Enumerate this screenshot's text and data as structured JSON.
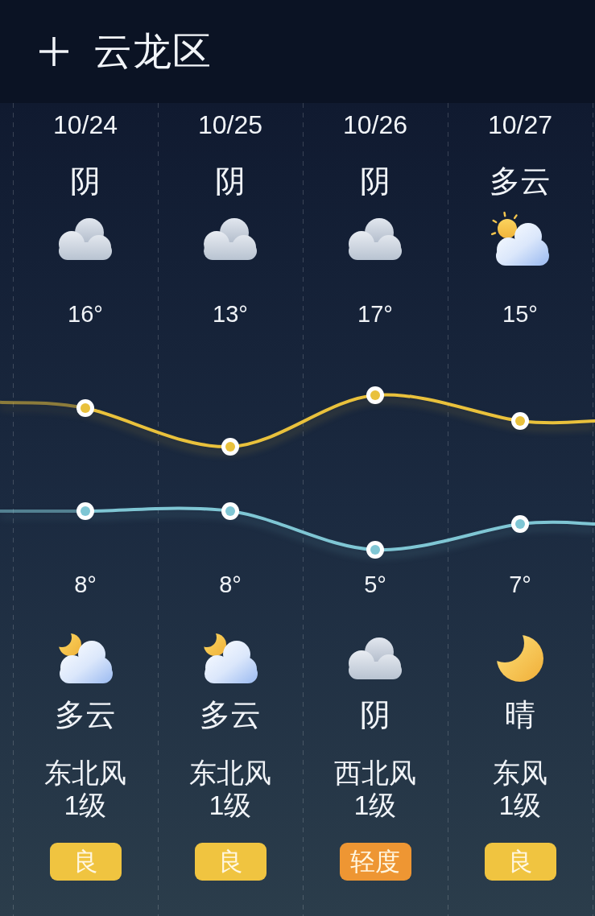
{
  "header": {
    "title": "云龙区"
  },
  "forecast": {
    "days": [
      {
        "date": "10/24",
        "day": {
          "condition": "阴",
          "kind": "overcast"
        },
        "night": {
          "condition": "多云",
          "kind": "partly-cloudy"
        },
        "wind": "东北风",
        "wind_level": "1级",
        "air_quality": {
          "label": "良",
          "color": "#f0c440"
        }
      },
      {
        "date": "10/25",
        "day": {
          "condition": "阴",
          "kind": "overcast"
        },
        "night": {
          "condition": "多云",
          "kind": "partly-cloudy"
        },
        "wind": "东北风",
        "wind_level": "1级",
        "air_quality": {
          "label": "良",
          "color": "#f0c440"
        }
      },
      {
        "date": "10/26",
        "day": {
          "condition": "阴",
          "kind": "overcast"
        },
        "night": {
          "condition": "阴",
          "kind": "overcast"
        },
        "wind": "西北风",
        "wind_level": "1级",
        "air_quality": {
          "label": "轻度",
          "color": "#ee9633"
        }
      },
      {
        "date": "10/27",
        "day": {
          "condition": "多云",
          "kind": "partly-cloudy"
        },
        "night": {
          "condition": "晴",
          "kind": "clear"
        },
        "wind": "东风",
        "wind_level": "1级",
        "air_quality": {
          "label": "良",
          "color": "#f0c440"
        }
      }
    ],
    "chart_data": {
      "type": "line",
      "series": [
        {
          "color": "#e9c13c",
          "marker": "circle",
          "values": [
            16,
            13,
            17,
            15
          ],
          "value_labels": [
            "16°",
            "13°",
            "17°",
            "15°"
          ]
        },
        {
          "color": "#7fc6d4",
          "marker": "circle",
          "values": [
            8,
            8,
            5,
            7
          ],
          "value_labels": [
            "8°",
            "8°",
            "5°",
            "7°"
          ]
        }
      ]
    }
  }
}
